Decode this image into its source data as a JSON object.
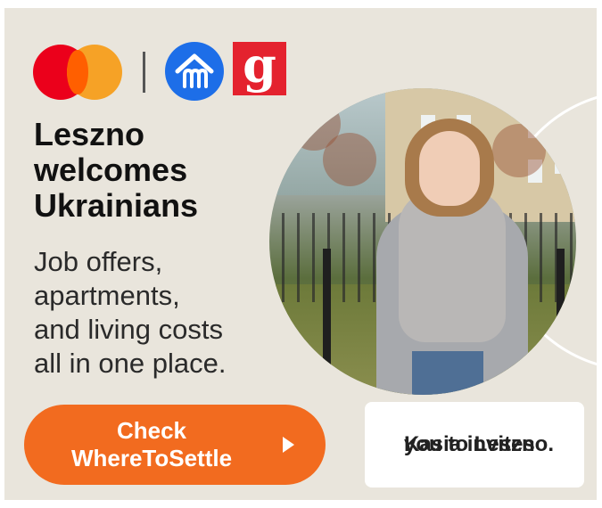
{
  "headline": {
    "line1": "Leszno",
    "line2": "welcomes",
    "line3": "Ukrainians"
  },
  "body": {
    "line1": "Job offers,",
    "line2": "apartments,",
    "line3": "and living costs",
    "line4": "all in one place."
  },
  "cta": {
    "line1": "Check",
    "line2": "WhereToSettle"
  },
  "caption": {
    "line1": "Kasia invites",
    "line2": "you to Leszno."
  },
  "logos": {
    "partner_g_letter": "g",
    "icons": [
      "mastercard-logo",
      "house-icon",
      "g-logo"
    ]
  },
  "colors": {
    "background": "#e9e5dc",
    "cta": "#f26b1f",
    "mastercard_red": "#eb001b",
    "mastercard_yellow": "#f79e1b",
    "house_blue": "#1d6ee8",
    "g_red": "#e4222e"
  }
}
